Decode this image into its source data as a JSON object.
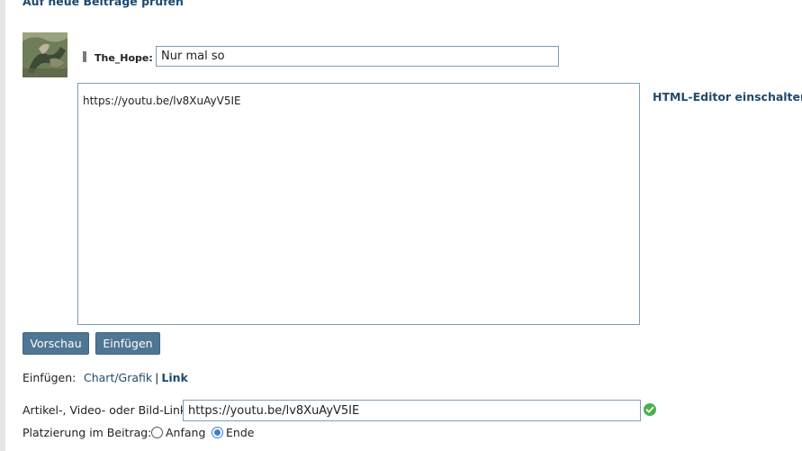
{
  "top_link": "Auf neue Beiträge prüfen",
  "author": {
    "username": "The_Hope:"
  },
  "title_input": {
    "value": "Nur mal so"
  },
  "body": {
    "value": "https://youtu.be/lv8XuAyV5IE"
  },
  "html_editor_link": "HTML-Editor einschalten",
  "buttons": {
    "preview": "Vorschau",
    "insert": "Einfügen"
  },
  "insert_row": {
    "label": "Einfügen:",
    "options": [
      "Chart/Grafik",
      "Link"
    ],
    "separator": "|",
    "active": "Link"
  },
  "link_field": {
    "label": "Artikel-, Video- oder Bild-Link:",
    "value": "https://youtu.be/lv8XuAyV5IE",
    "valid": true
  },
  "placement": {
    "label": "Platzierung im Beitrag:",
    "options": [
      "Anfang",
      "Ende"
    ],
    "selected": "Ende"
  },
  "colors": {
    "accent": "#4f7693",
    "link": "#1f4a6e",
    "valid_check": "#4caf50",
    "radio_selected": "#3b7fd1"
  }
}
